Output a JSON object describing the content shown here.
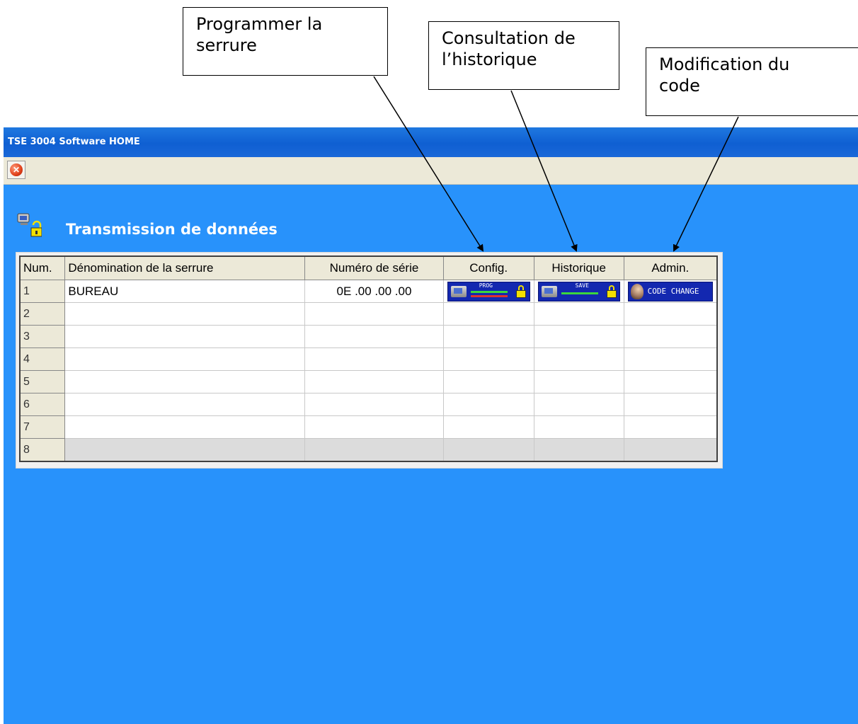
{
  "callouts": {
    "program": {
      "line1": "Programmer la",
      "line2": "serrure"
    },
    "history": {
      "line1": "Consultation de",
      "line2": "l’historique"
    },
    "code": {
      "line1": "Modification du",
      "line2": "code"
    }
  },
  "window": {
    "title": "TSE 3004 Software HOME",
    "close_icon": "close-icon",
    "section_title": "Transmission de données",
    "section_icon": "computer-lock-icon"
  },
  "table": {
    "headers": {
      "num": "Num.",
      "name": "Dénomination de la serrure",
      "serial": "Numéro de série",
      "config": "Config.",
      "history": "Historique",
      "admin": "Admin."
    },
    "rows": [
      {
        "num": "1",
        "name": "BUREAU",
        "serial": "0E .00 .00 .00"
      },
      {
        "num": "2",
        "name": "",
        "serial": ""
      },
      {
        "num": "3",
        "name": "",
        "serial": ""
      },
      {
        "num": "4",
        "name": "",
        "serial": ""
      },
      {
        "num": "5",
        "name": "",
        "serial": ""
      },
      {
        "num": "6",
        "name": "",
        "serial": ""
      },
      {
        "num": "7",
        "name": "",
        "serial": ""
      },
      {
        "num": "8",
        "name": "",
        "serial": ""
      }
    ],
    "buttons": {
      "config_tag": "PROG",
      "history_tag": "SAVE",
      "admin_label": "CODE CHANGE"
    }
  },
  "colors": {
    "window_bg": "#2892fb",
    "titlebar": "#0f5fd2",
    "button_bg": "#1328b0",
    "prog_arrow": "#3cd63c",
    "prog_return": "#e03030",
    "lock": "#f3e000"
  }
}
